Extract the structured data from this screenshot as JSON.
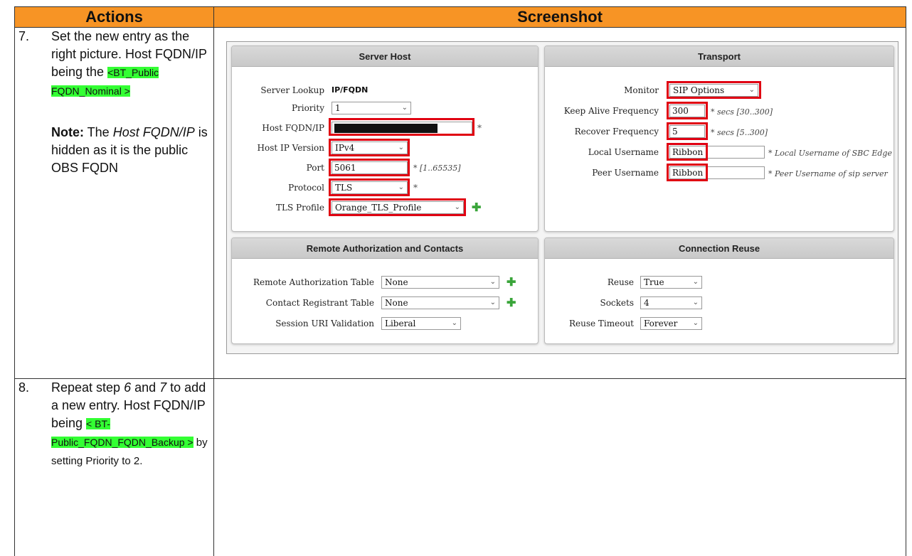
{
  "table": {
    "col_actions": "Actions",
    "col_screenshot": "Screenshot"
  },
  "step7": {
    "num": "7.",
    "text1": "Set the new entry as the right picture. Host FQDN/IP being the",
    "hl": "<BT_Public FQDN_Nominal >",
    "note_label": "Note:",
    "note_text1": " The ",
    "note_ital": "Host FQDN/IP",
    "note_text2": " is hidden as it is the public OBS FQDN"
  },
  "step8": {
    "num": "8.",
    "text_a": "Repeat step ",
    "ital_a": "6",
    "text_b": " and ",
    "ital_b": "7",
    "text_c": " to add a new entry. Host FQDN/IP being ",
    "hl": "< BT-Public_FQDN_FQDN_Backup >",
    "text_d": "  by setting Priority to 2."
  },
  "server_host": {
    "title": "Server Host",
    "lookup_label": "Server Lookup",
    "lookup_value": "IP/FQDN",
    "priority_label": "Priority",
    "priority_value": "1",
    "host_label": "Host FQDN/IP",
    "host_star": "*",
    "ipver_label": "Host IP Version",
    "ipver_value": "IPv4",
    "port_label": "Port",
    "port_value": "5061",
    "port_hint": "* [1..65535]",
    "protocol_label": "Protocol",
    "protocol_value": "TLS",
    "protocol_star": "*",
    "tls_label": "TLS Profile",
    "tls_value": "Orange_TLS_Profile"
  },
  "transport": {
    "title": "Transport",
    "monitor_label": "Monitor",
    "monitor_value": "SIP Options",
    "keepalive_label": "Keep Alive Frequency",
    "keepalive_value": "300",
    "keepalive_hint": "* secs [30..300]",
    "recover_label": "Recover Frequency",
    "recover_value": "5",
    "recover_hint": "* secs [5..300]",
    "local_label": "Local Username",
    "local_value": "Ribbon",
    "local_hint": "* Local Username of SBC Edge",
    "peer_label": "Peer Username",
    "peer_value": "Ribbon",
    "peer_hint": "* Peer Username of sip server"
  },
  "remote_auth": {
    "title": "Remote Authorization and Contacts",
    "rat_label": "Remote Authorization Table",
    "rat_value": "None",
    "crt_label": "Contact Registrant Table",
    "crt_value": "None",
    "suv_label": "Session URI Validation",
    "suv_value": "Liberal"
  },
  "conn_reuse": {
    "title": "Connection Reuse",
    "reuse_label": "Reuse",
    "reuse_value": "True",
    "sockets_label": "Sockets",
    "sockets_value": "4",
    "timeout_label": "Reuse Timeout",
    "timeout_value": "Forever"
  },
  "icons": {
    "chevron": "chevron-down-icon",
    "add": "plus-icon"
  },
  "colors": {
    "header": "#f79425",
    "highlight": "#33ff33",
    "red_outline": "#e00012",
    "add_icon": "#3aa53a"
  }
}
